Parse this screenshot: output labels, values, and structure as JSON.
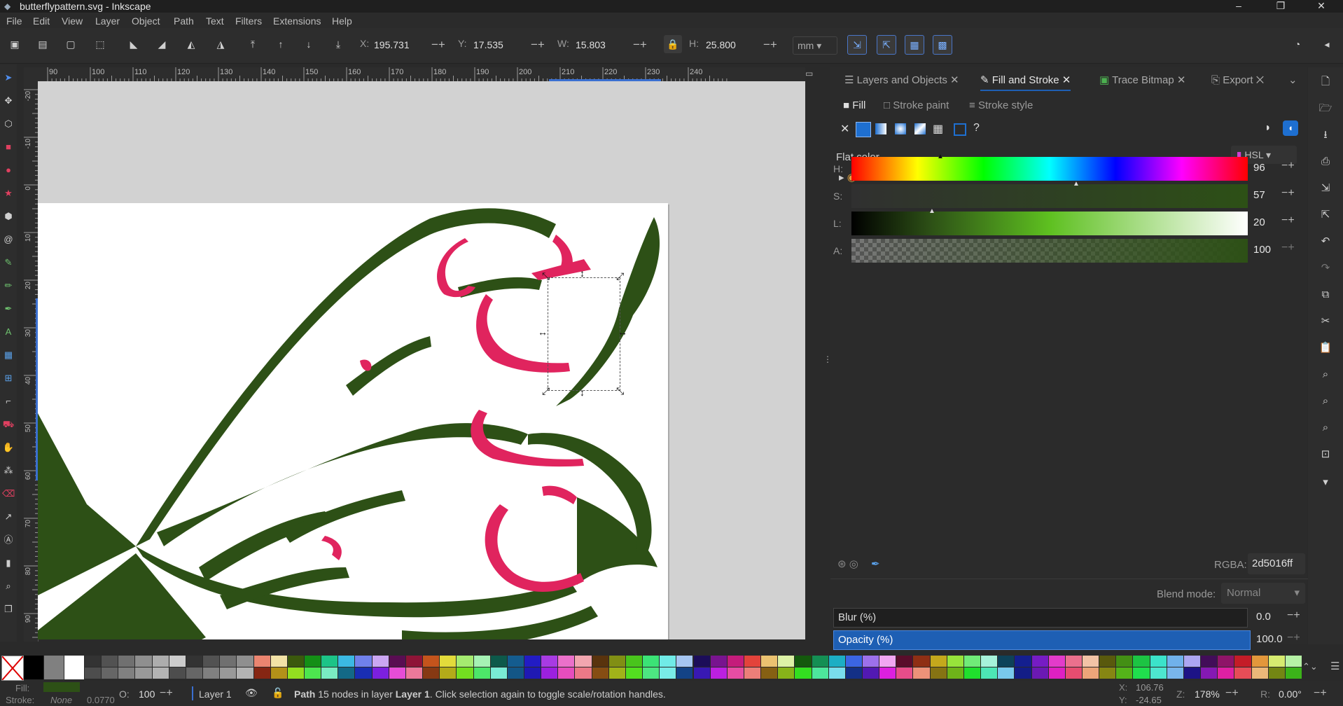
{
  "window": {
    "title": "butterflypattern.svg - Inkscape",
    "minimize": "–",
    "maximize": "❐",
    "close": "✕"
  },
  "menu": [
    "File",
    "Edit",
    "View",
    "Layer",
    "Object",
    "Path",
    "Text",
    "Filters",
    "Extensions",
    "Help"
  ],
  "toolbar": {
    "x_label": "X:",
    "x_value": "195.731",
    "y_label": "Y:",
    "y_value": "17.535",
    "w_label": "W:",
    "w_value": "15.803",
    "h_label": "H:",
    "h_value": "25.800",
    "unit": "mm"
  },
  "ruler": {
    "h_ticks": [
      "90",
      "100",
      "110",
      "120",
      "130",
      "140",
      "150",
      "160",
      "170",
      "180",
      "190",
      "200",
      "210",
      "220",
      "230",
      "240"
    ],
    "v_ticks": [
      "-20",
      "-10",
      "0",
      "10",
      "20",
      "30",
      "40",
      "50",
      "60",
      "70",
      "80",
      "90"
    ]
  },
  "panel": {
    "tabs": [
      {
        "label": "Layers and Objects",
        "icon": "layers-icon"
      },
      {
        "label": "Fill and Stroke",
        "icon": "fill-stroke-icon"
      },
      {
        "label": "Trace Bitmap",
        "icon": "trace-bitmap-icon"
      },
      {
        "label": "Export",
        "icon": "export-icon"
      }
    ],
    "subtabs": [
      "Fill",
      "Stroke paint",
      "Stroke style"
    ],
    "flat_color": "Flat color",
    "color_mode": "HSL",
    "color_wheel": "Color Wheel",
    "sliders": [
      {
        "label": "H:",
        "value": "96"
      },
      {
        "label": "S:",
        "value": "57"
      },
      {
        "label": "L:",
        "value": "20"
      },
      {
        "label": "A:",
        "value": "100"
      }
    ],
    "rgba_label": "RGBA:",
    "rgba_value": "2d5016ff",
    "blend_label": "Blend mode:",
    "blend_value": "Normal",
    "blur_label": "Blur (%)",
    "blur_value": "0.0",
    "opacity_label": "Opacity (%)",
    "opacity_value": "100.0"
  },
  "colors": {
    "fill": "#2d5016",
    "accent": "#1e5fb4",
    "pink": "#e0245e"
  },
  "status": {
    "fill_label": "Fill:",
    "stroke_label": "Stroke:",
    "stroke_value": "None",
    "stroke_width": "0.0770",
    "opacity_label": "O:",
    "opacity_value": "100",
    "layer": "Layer 1",
    "message_bold": "Path",
    "message_mid": " 15 nodes in layer ",
    "message_layer": "Layer 1",
    "message_tail": ". Click selection again to toggle scale/rotation handles.",
    "x_label": "X:",
    "x_value": "106.76",
    "y_label": "Y:",
    "y_value": "-24.65",
    "z_label": "Z:",
    "z_value": "178%",
    "r_label": "R:",
    "r_value": "0.00°"
  }
}
